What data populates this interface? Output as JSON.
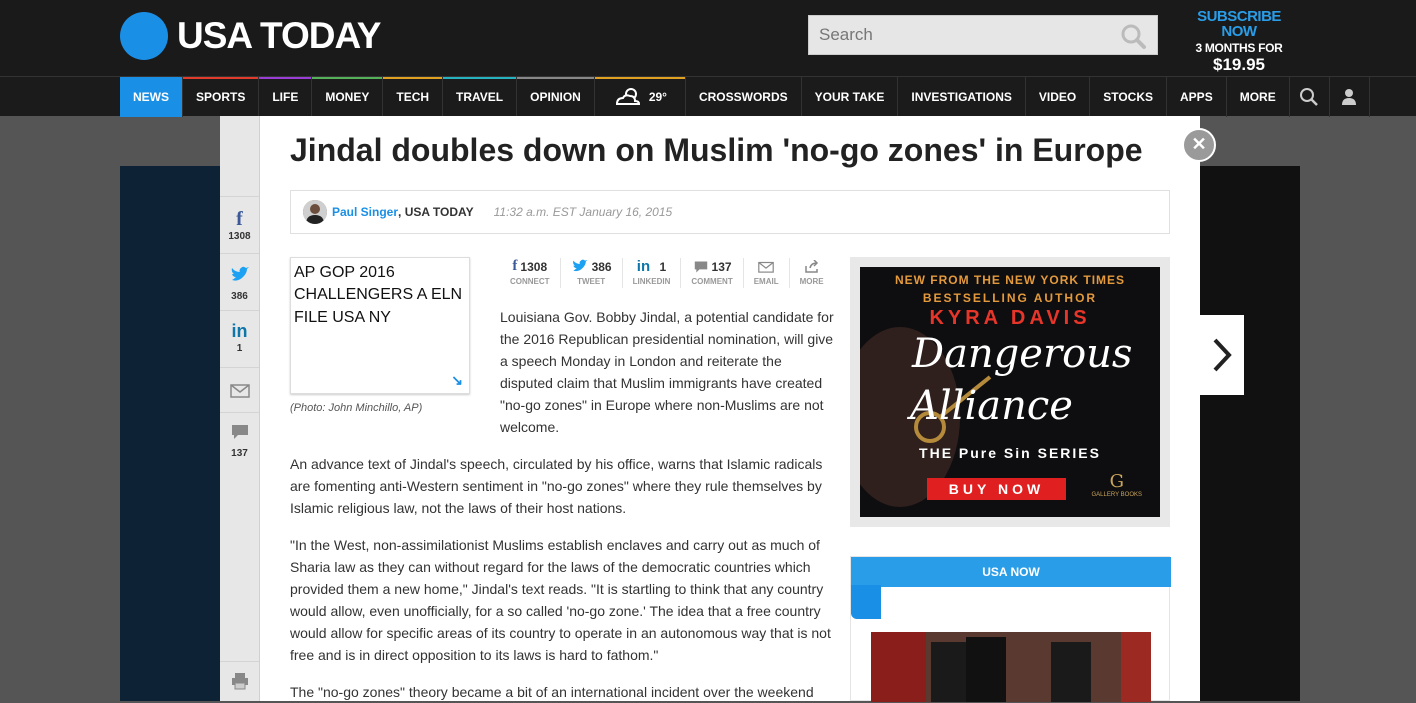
{
  "site": {
    "name": "USA TODAY",
    "search_placeholder": "Search",
    "promo": {
      "line1": "SUBSCRIBE NOW",
      "line2": "3 MONTHS FOR",
      "line3": "$19.95"
    }
  },
  "nav": {
    "items": [
      {
        "label": "NEWS",
        "color": "#1a8fe6"
      },
      {
        "label": "SPORTS",
        "color": "#e13b2b"
      },
      {
        "label": "LIFE",
        "color": "#9a3cd6"
      },
      {
        "label": "MONEY",
        "color": "#55b05a"
      },
      {
        "label": "TECH",
        "color": "#e0a020"
      },
      {
        "label": "TRAVEL",
        "color": "#27b2c2"
      },
      {
        "label": "OPINION",
        "color": "#888888"
      },
      {
        "label": "CROSSWORDS"
      },
      {
        "label": "YOUR TAKE"
      },
      {
        "label": "INVESTIGATIONS"
      },
      {
        "label": "VIDEO"
      },
      {
        "label": "STOCKS"
      },
      {
        "label": "APPS"
      },
      {
        "label": "MORE"
      }
    ],
    "weather": {
      "temp": "29°"
    }
  },
  "rail": {
    "facebook_count": "1308",
    "twitter_count": "386",
    "linkedin_count": "1",
    "comment_count": "137"
  },
  "article": {
    "headline": "Jindal doubles down on Muslim 'no-go zones' in Europe",
    "author": "Paul Singer",
    "org": ", USA TODAY",
    "timestamp": "11:32 a.m. EST January 16, 2015",
    "photo_alt": "AP GOP 2016 CHALLENGERS A ELN FILE USA NY",
    "photo_credit": "(Photo: John Minchillo, AP)",
    "share": [
      {
        "count": "1308",
        "label": "CONNECT"
      },
      {
        "count": "386",
        "label": "TWEET"
      },
      {
        "count": "1",
        "label": "LINKEDIN"
      },
      {
        "count": "137",
        "label": "COMMENT"
      },
      {
        "count": "",
        "label": "EMAIL"
      },
      {
        "count": "",
        "label": "MORE"
      }
    ],
    "paragraphs": [
      "Louisiana Gov. Bobby Jindal, a potential candidate for the 2016 Republican presidential nomination, will give a speech Monday in London and reiterate the disputed claim that Muslim immigrants have created \"no-go zones\" in Europe where non-Muslims are not welcome.",
      "An advance text of Jindal's speech, circulated by his office, warns that Islamic radicals are fomenting anti-Western sentiment in \"no-go zones\" where they rule themselves by Islamic religious law, not the laws of their host nations.",
      "\"In the West, non-assimilationist Muslims establish enclaves and carry out as much of Sharia law as they can without regard for the laws of the democratic countries which provided them a new home,\" Jindal's text reads. \"It is startling to think that any country would allow, even unofficially, for a so called 'no-go zone.' The idea that a free country would allow for specific areas of its country to operate in an autonomous way that is not free and is in direct opposition to its laws is hard to fathom.\"",
      "The \"no-go zones\" theory became a bit of an international incident over the weekend"
    ]
  },
  "ad": {
    "line1": "NEW FROM THE NEW YORK TIMES",
    "line2": "BESTSELLING AUTHOR",
    "author": "KYRA DAVIS",
    "title1": "Dangerous",
    "title2": "Alliance",
    "series": "THE Pure Sin SERIES",
    "cta": "BUY NOW",
    "publisher_mark": "G",
    "publisher": "GALLERY BOOKS"
  },
  "sidebar": {
    "usa_now_title": "USA NOW"
  }
}
